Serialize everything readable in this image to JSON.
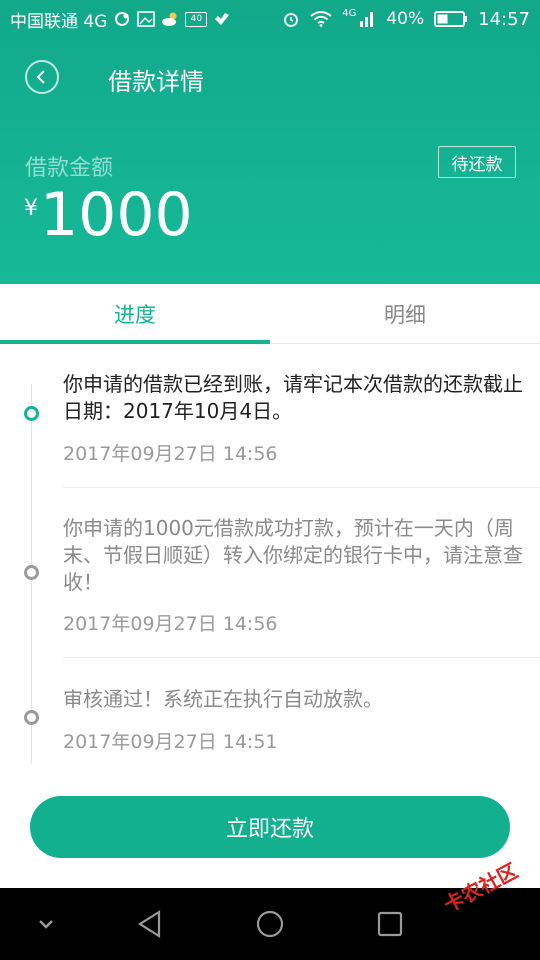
{
  "status_bar": {
    "carrier": "中国联通 4G",
    "network_badge": "4G",
    "battery": "40%",
    "time": "14:57",
    "battery_small": "40",
    "icons": [
      "notification-icon",
      "image-icon",
      "weather-icon",
      "battery-badge-icon",
      "clean-icon",
      "alarm-icon",
      "wifi-icon",
      "signal-icon",
      "battery-icon"
    ]
  },
  "header": {
    "title": "借款详情",
    "amount_label": "借款金额",
    "currency": "¥",
    "amount": "1000",
    "status": "待还款"
  },
  "tabs": [
    {
      "label": "进度",
      "active": true
    },
    {
      "label": "明细",
      "active": false
    }
  ],
  "timeline": [
    {
      "text": "你申请的借款已经到账，请牢记本次借款的还款截止日期：2017年10月4日。",
      "time": "2017年09月27日 14:56",
      "active": true
    },
    {
      "text": "你申请的1000元借款成功打款，预计在一天内（周末、节假日顺延）转入你绑定的银行卡中，请注意查收！",
      "time": "2017年09月27日 14:56",
      "active": false
    },
    {
      "text": "审核通过！系统正在执行自动放款。",
      "time": "2017年09月27日 14:51",
      "active": false
    }
  ],
  "actions": {
    "repay_label": "立即还款"
  },
  "watermark": "卡农社区",
  "colors": {
    "accent": "#14b394",
    "header_top": "#12a88a",
    "navbar": "#000000"
  }
}
